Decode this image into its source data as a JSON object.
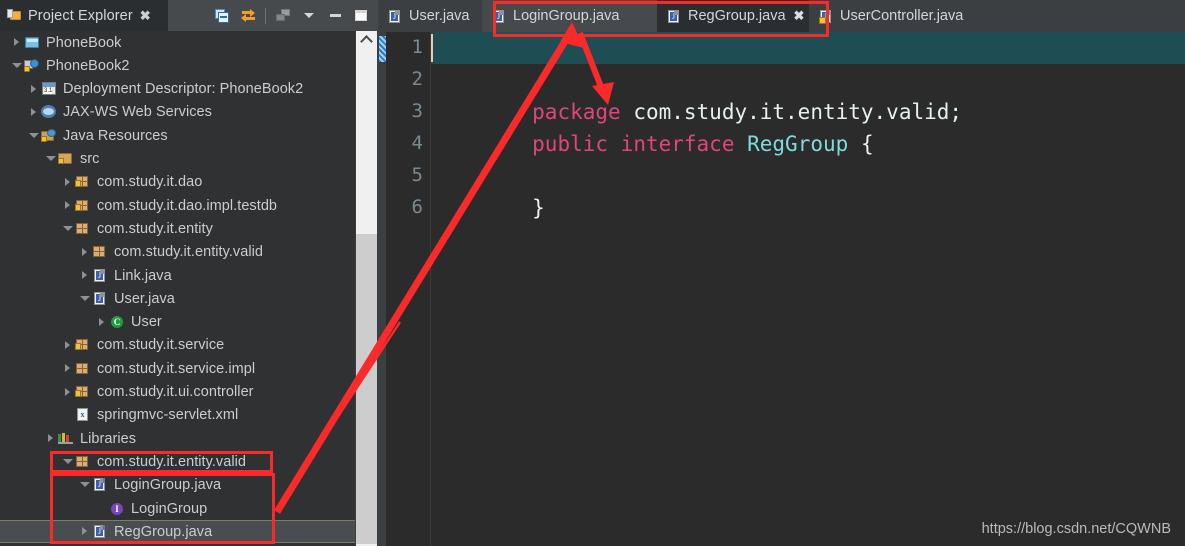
{
  "left_panel": {
    "view_tab": {
      "label": "Project Explorer",
      "close_glyph": "✖",
      "icon": "project-explorer-icon"
    },
    "toolbar": [
      {
        "name": "collapse-all-button",
        "icon": "collapse-all-icon"
      },
      {
        "name": "link-with-editor-button",
        "icon": "link-editor-icon"
      },
      {
        "name": "view-menu-gray-button",
        "icon": "focus-on-active-task-icon"
      },
      {
        "name": "view-menu-button",
        "icon": "chevron-down-icon"
      },
      {
        "name": "minimize-button",
        "icon": "minimize-icon"
      },
      {
        "name": "maximize-button",
        "icon": "maximize-icon"
      }
    ],
    "tree": [
      {
        "label": "PhoneBook",
        "indent": 0,
        "twisty": "closed",
        "icon": "folder",
        "selected": false
      },
      {
        "label": "PhoneBook2",
        "indent": 0,
        "twisty": "open",
        "icon": "project",
        "selected": false
      },
      {
        "label": "Deployment Descriptor: PhoneBook2",
        "indent": 1,
        "twisty": "closed",
        "icon": "descriptor",
        "selected": false
      },
      {
        "label": "JAX-WS Web Services",
        "indent": 1,
        "twisty": "closed",
        "icon": "webservice",
        "selected": false
      },
      {
        "label": "Java Resources",
        "indent": 1,
        "twisty": "open",
        "icon": "javares",
        "selected": false
      },
      {
        "label": "src",
        "indent": 2,
        "twisty": "open",
        "icon": "srcfolder",
        "selected": false
      },
      {
        "label": "com.study.it.dao",
        "indent": 3,
        "twisty": "closed",
        "icon": "pkg-lock",
        "selected": false
      },
      {
        "label": "com.study.it.dao.impl.testdb",
        "indent": 3,
        "twisty": "closed",
        "icon": "pkg-lock",
        "selected": false
      },
      {
        "label": "com.study.it.entity",
        "indent": 3,
        "twisty": "open",
        "icon": "pkg",
        "selected": false
      },
      {
        "label": "com.study.it.entity.valid",
        "indent": 4,
        "twisty": "closed",
        "icon": "pkg",
        "selected": false
      },
      {
        "label": "Link.java",
        "indent": 4,
        "twisty": "closed",
        "icon": "java",
        "selected": false
      },
      {
        "label": "User.java",
        "indent": 4,
        "twisty": "open",
        "icon": "java",
        "selected": false
      },
      {
        "label": "User",
        "indent": 5,
        "twisty": "closed",
        "icon": "class",
        "selected": false
      },
      {
        "label": "com.study.it.service",
        "indent": 3,
        "twisty": "closed",
        "icon": "pkg-lock",
        "selected": false
      },
      {
        "label": "com.study.it.service.impl",
        "indent": 3,
        "twisty": "closed",
        "icon": "pkg",
        "selected": false
      },
      {
        "label": "com.study.it.ui.controller",
        "indent": 3,
        "twisty": "closed",
        "icon": "pkg-lock",
        "selected": false
      },
      {
        "label": "springmvc-servlet.xml",
        "indent": 3,
        "twisty": "none",
        "icon": "xml",
        "selected": false
      },
      {
        "label": "Libraries",
        "indent": 2,
        "twisty": "closed",
        "icon": "libraries",
        "selected": false
      },
      {
        "label": "com.study.it.entity.valid",
        "indent": 3,
        "twisty": "open",
        "icon": "pkg",
        "selected": false
      },
      {
        "label": "LoginGroup.java",
        "indent": 4,
        "twisty": "open",
        "icon": "java-iface",
        "selected": false
      },
      {
        "label": "LoginGroup",
        "indent": 5,
        "twisty": "none",
        "icon": "interface",
        "selected": false
      },
      {
        "label": "RegGroup.java",
        "indent": 4,
        "twisty": "closed",
        "icon": "java-iface",
        "selected": true
      }
    ],
    "scrollbar": {
      "name": "tree-vertical-scrollbar"
    }
  },
  "editor": {
    "tabs": [
      {
        "label": "User.java",
        "state": "inactive",
        "icon": "java-file-icon",
        "closable": false
      },
      {
        "label": "LoginGroup.java",
        "state": "semi",
        "icon": "java-file-icon",
        "closable": false
      },
      {
        "label": "RegGroup.java",
        "state": "active",
        "icon": "java-file-icon",
        "closable": true,
        "close_glyph": "✖"
      },
      {
        "label": "UserController.java",
        "state": "inactive",
        "icon": "java-file-warning-icon",
        "closable": false
      }
    ],
    "line_numbers": [
      "1",
      "2",
      "3",
      "4",
      "5",
      "6"
    ],
    "code": {
      "l1_kw": "package",
      "l1_rest": " com.study.it.entity.valid;",
      "l3_kw1": "public",
      "l3_kw2": "interface",
      "l3_type": "RegGroup",
      "l3_brace": "{",
      "l5_brace": "}"
    }
  },
  "watermark": {
    "text": "https://blog.csdn.net/CQWNB"
  },
  "annotations": {
    "accent_color": "#fb2a2a",
    "boxes": [
      {
        "name": "tab-highlight-box"
      },
      {
        "name": "package-node-highlight-box"
      },
      {
        "name": "group-files-highlight-box"
      }
    ],
    "arrows": [
      {
        "name": "tree-to-tab-arrow"
      },
      {
        "name": "tab-to-interface-arrow"
      }
    ]
  }
}
